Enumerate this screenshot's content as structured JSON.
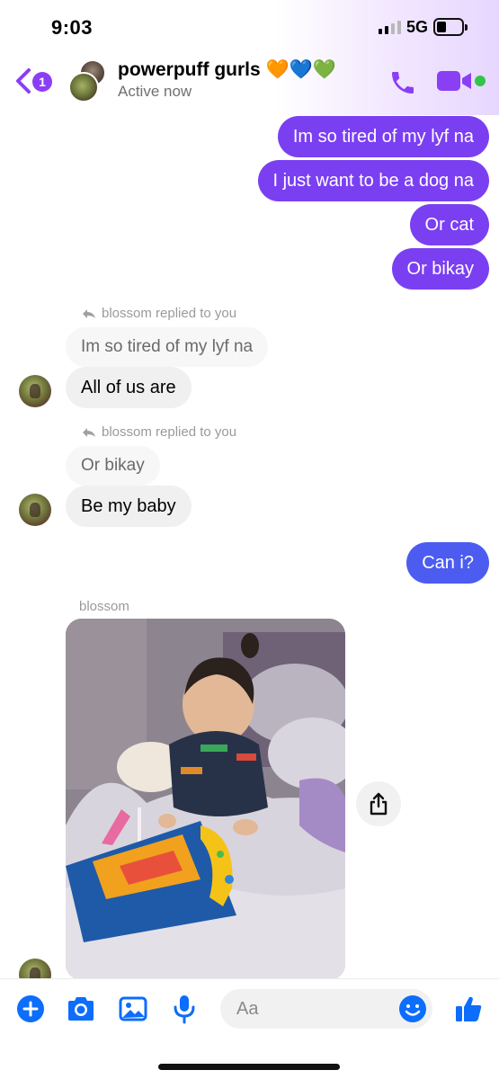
{
  "status_bar": {
    "time": "9:03",
    "network": "5G"
  },
  "header": {
    "back_badge": "1",
    "chat_title": "powerpuff gurls 🧡💙💚",
    "status": "Active now"
  },
  "messages": {
    "out1": "Im so tired of my lyf na",
    "out2": "I just want to be a dog na",
    "out3": "Or cat",
    "out4": "Or bikay",
    "reply1_note": "blossom replied to you",
    "reply1_quote": "Im so tired of my lyf na",
    "reply1_text": "All of us are",
    "reply2_note": "blossom replied to you",
    "reply2_quote": "Or bikay",
    "reply2_text": "Be my baby",
    "out5": "Can i?",
    "photo_sender": "blossom"
  },
  "composer": {
    "placeholder": "Aa"
  },
  "colors": {
    "accent_purple": "#7b3ff2",
    "accent_blue": "#4c5cf0",
    "online_green": "#31c54a"
  }
}
